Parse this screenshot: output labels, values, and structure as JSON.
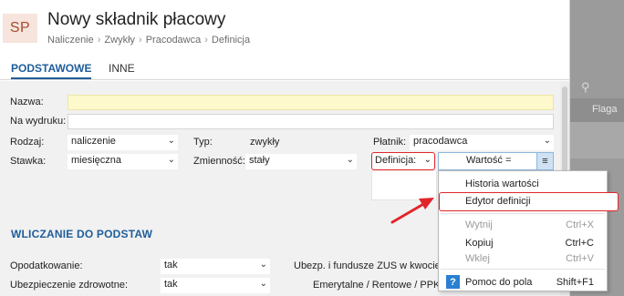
{
  "window": {
    "avatar": "SP",
    "title": "Nowy składnik płacowy",
    "breadcrumb": [
      "Naliczenie",
      "Zwykły",
      "Pracodawca",
      "Definicja"
    ]
  },
  "tabs": [
    {
      "label": "PODSTAWOWE",
      "active": true
    },
    {
      "label": "INNE",
      "active": false
    }
  ],
  "form": {
    "nazwa": {
      "label": "Nazwa:",
      "value": ""
    },
    "wydruk": {
      "label": "Na wydruku:",
      "value": ""
    },
    "rodzaj": {
      "label": "Rodzaj:",
      "value": "naliczenie"
    },
    "typ": {
      "label": "Typ:",
      "value": "zwykły"
    },
    "platnik": {
      "label": "Płatnik:",
      "value": "pracodawca"
    },
    "stawka": {
      "label": "Stawka:",
      "value": "miesięczna"
    },
    "zmiennosc": {
      "label": "Zmienność:",
      "value": "stały"
    },
    "definicja": {
      "value": "Definicja:"
    },
    "wartosc": {
      "value": "Wartość ="
    }
  },
  "section": {
    "title": "WLICZANIE DO PODSTAW",
    "opodatkowanie": {
      "label": "Opodatkowanie:",
      "value": "tak"
    },
    "zdrowotne": {
      "label": "Ubezpieczenie zdrowotne:",
      "value": "tak"
    },
    "zus": {
      "label": "Ubezp. i fundusze ZUS w kwocie:"
    },
    "emerytalne": {
      "label": "Emerytalne / Rentowe / PPK:"
    }
  },
  "context_menu": [
    {
      "label": "Historia wartości",
      "shortcut": "",
      "enabled": true
    },
    {
      "label": "Edytor definicji",
      "shortcut": "",
      "enabled": true,
      "highlighted": true
    },
    {
      "label": "Wytnij",
      "shortcut": "Ctrl+X",
      "enabled": false
    },
    {
      "label": "Kopiuj",
      "shortcut": "Ctrl+C",
      "enabled": true
    },
    {
      "label": "Wklej",
      "shortcut": "Ctrl+V",
      "enabled": false
    },
    {
      "label": "Pomoc do pola",
      "shortcut": "Shift+F1",
      "enabled": true
    }
  ],
  "background": {
    "column_label": "Flaga"
  },
  "colors": {
    "accent": "#1f5d9a",
    "highlight": "#e0262b",
    "name_field": "#fdf9cc"
  }
}
